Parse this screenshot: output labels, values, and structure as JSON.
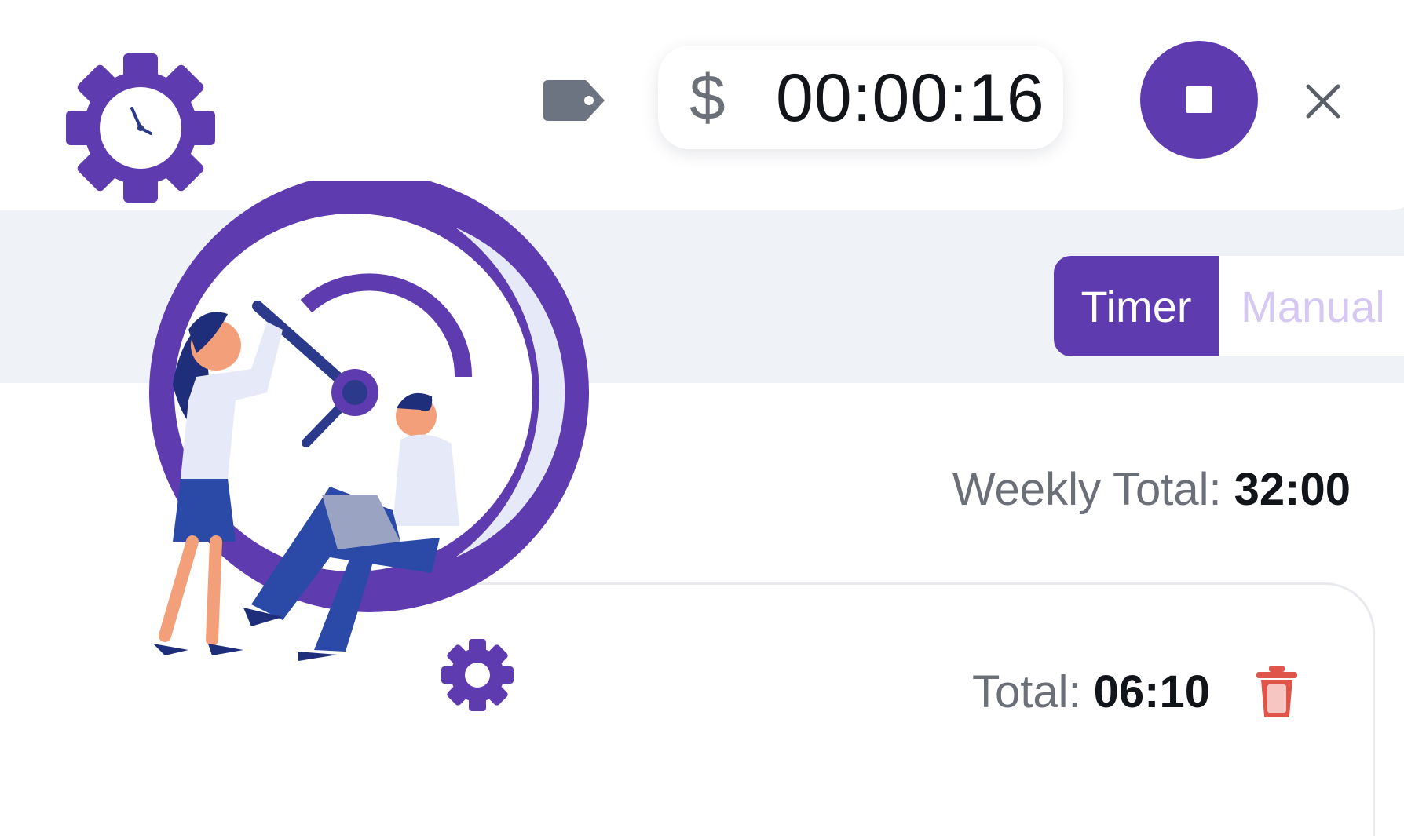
{
  "header": {
    "timer_value": "00:00:16",
    "billable_symbol": "$",
    "icons": [
      "gear-clock-logo-icon",
      "tag-icon",
      "stop-icon",
      "close-icon"
    ]
  },
  "mode_toggle": {
    "timer_label": "Timer",
    "manual_label": "Manual",
    "active": "Timer"
  },
  "summary": {
    "weekly_label": "Weekly Total:",
    "weekly_value": "32:00"
  },
  "day": {
    "total_label": "Total:",
    "total_value": "06:10"
  },
  "colors": {
    "accent": "#5f3bb0",
    "accent_light": "#d5c9f3",
    "band": "#eff2f7",
    "text_dark": "#111418",
    "text_grey": "#6b6f77",
    "danger": "#e0554a"
  }
}
